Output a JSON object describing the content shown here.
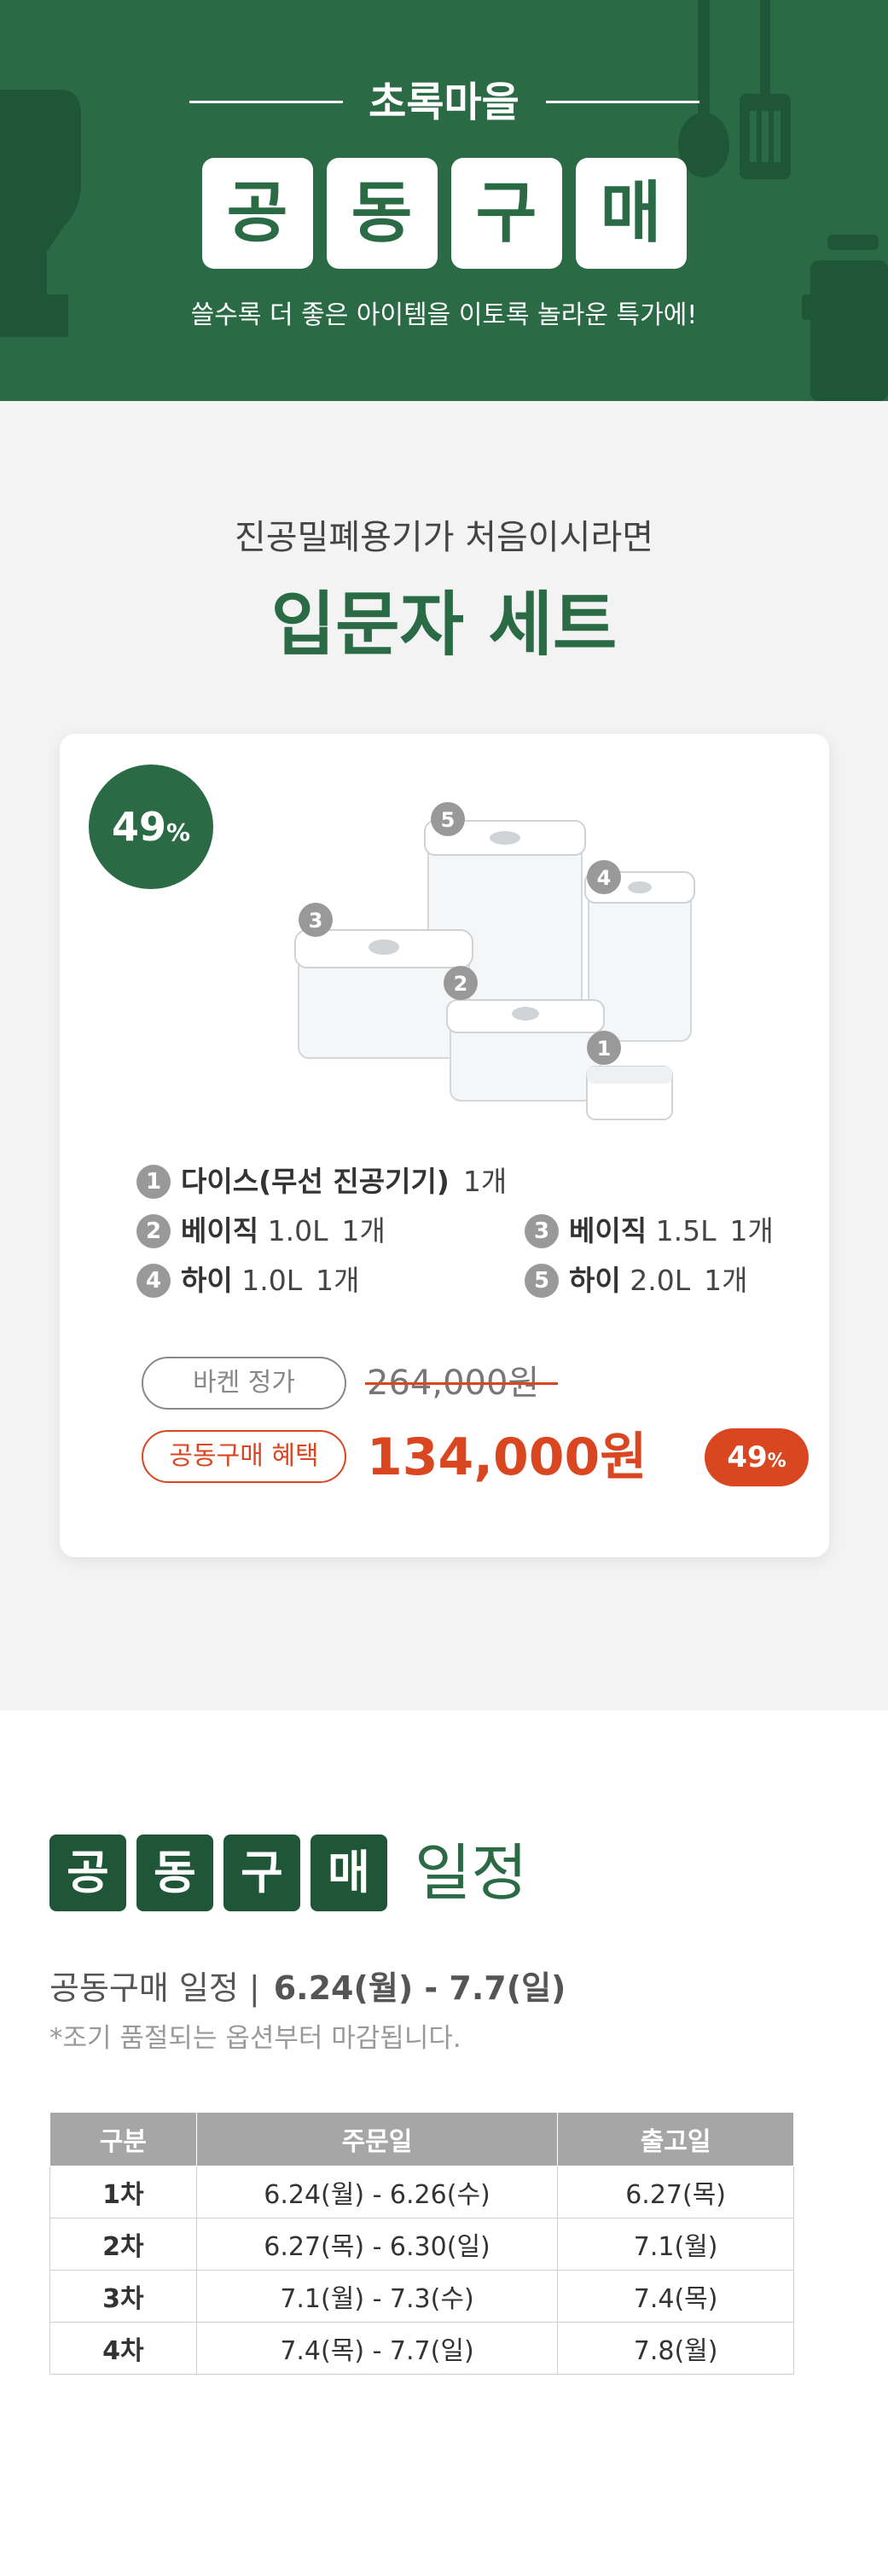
{
  "hero": {
    "title": "초록마을",
    "tiles": [
      "공",
      "동",
      "구",
      "매"
    ],
    "subtitle": "쓸수록 더 좋은 아이템을 이토록 놀라운 특가에!"
  },
  "set": {
    "kicker": "진공밀폐용기가 처음이시라면",
    "title": "입문자 세트",
    "discount_badge": {
      "num": "49",
      "unit": "%"
    },
    "product_image": {
      "markers": [
        "1",
        "2",
        "3",
        "4",
        "5"
      ]
    },
    "items": [
      {
        "num": "1",
        "name": "다이스(무선 진공기기)",
        "spec": "",
        "qty": "1개"
      },
      {
        "num": "2",
        "name": "베이직",
        "spec": "1.0L",
        "qty": "1개"
      },
      {
        "num": "3",
        "name": "베이직",
        "spec": "1.5L",
        "qty": "1개"
      },
      {
        "num": "4",
        "name": "하이",
        "spec": "1.0L",
        "qty": "1개"
      },
      {
        "num": "5",
        "name": "하이",
        "spec": "2.0L",
        "qty": "1개"
      }
    ],
    "price": {
      "regular_label": "바켄 정가",
      "regular_price": "264,000원",
      "deal_label": "공동구매 혜택",
      "deal_price": "134,000원",
      "deal_pct": {
        "num": "49",
        "unit": "%"
      }
    }
  },
  "schedule": {
    "tiles": [
      "공",
      "동",
      "구",
      "매"
    ],
    "heading_word": "일정",
    "period_label": "공동구매 일정 |",
    "period_value": "6.24(월) - 7.7(일)",
    "note": "*조기 품절되는 옵션부터 마감됩니다.",
    "table": {
      "headers": [
        "구분",
        "주문일",
        "출고일"
      ],
      "rows": [
        [
          "1차",
          "6.24(월) - 6.26(수)",
          "6.27(목)"
        ],
        [
          "2차",
          "6.27(목) - 6.30(일)",
          "7.1(월)"
        ],
        [
          "3차",
          "7.1(월) - 7.3(수)",
          "7.4(목)"
        ],
        [
          "4차",
          "7.4(목) - 7.7(일)",
          "7.8(월)"
        ]
      ]
    }
  },
  "colors": {
    "brand_green": "#2a6b45",
    "dark_green": "#1f5637",
    "accent_red": "#d9461f",
    "section_gray": "#f3f3f3"
  }
}
